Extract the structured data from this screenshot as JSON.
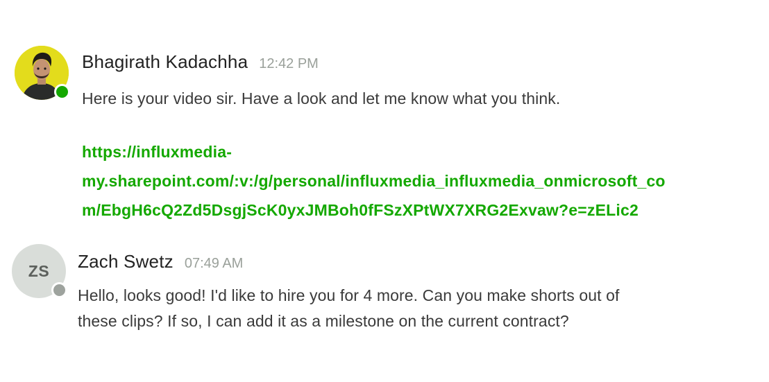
{
  "messages": [
    {
      "sender": "Bhagirath Kadachha",
      "time": "12:42 PM",
      "presence": "online",
      "avatar": {
        "type": "photo",
        "icon": "user-photo"
      },
      "text": "Here is your video sir. Have a look and let me know what you think.",
      "link": {
        "lines": [
          "https://influxmedia-",
          "my.sharepoint.com/:v:/g/personal/influxmedia_influxmedia_onmicrosoft_co",
          "m/EbgH6cQ2Zd5DsgjScK0yxJMBoh0fFSzXPtWX7XRG2Exvaw?e=zELic2"
        ]
      }
    },
    {
      "sender": "Zach Swetz",
      "time": "07:49 AM",
      "presence": "offline",
      "avatar": {
        "type": "initials",
        "initials": "ZS"
      },
      "text_lines": [
        "Hello, looks good! I'd like to hire you for 4 more. Can you make shorts out of",
        "these clips? If so, I can add it as a milestone on the current contract?"
      ]
    }
  ],
  "colors": {
    "link": "#14a800",
    "online": "#14a800",
    "offline": "#9ea39e",
    "timestamp": "#9aa09a",
    "initials_bg": "#d9ddd9"
  }
}
